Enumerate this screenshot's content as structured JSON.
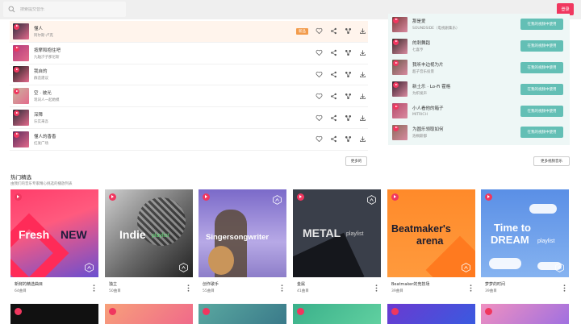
{
  "search": {
    "placeholder": "搜索提交音乐"
  },
  "header": {
    "login_label": "登录"
  },
  "tracks": [
    {
      "title": "懂人",
      "artist": "阿尔斯·卢克",
      "badge": "新品",
      "cover": "#2b2b3a",
      "active": true
    },
    {
      "title": "按摩和抱住吧",
      "artist": "九轴汐子那尼斯",
      "cover": "#b03a7a"
    },
    {
      "title": "我自的",
      "artist": "群造建议",
      "cover": "#1d1d1d"
    },
    {
      "title": "空 · 彼光",
      "artist": "现词人一起她模",
      "cover": "#c9b7a0"
    },
    {
      "title": "深障",
      "artist": "乐实来吾",
      "cover": "#272a35"
    },
    {
      "title": "懂人的香香",
      "artist": "红发广场",
      "cover": "#5a2a5a"
    }
  ],
  "tracks_more_label": "更多的",
  "right_panel": {
    "items": [
      {
        "title": "那是爱",
        "artist": "SOUNDSIDE（电视剧集乐）",
        "cover": "#7a3b3b"
      },
      {
        "title": "的刺舞蹈",
        "artist": "七喜亨",
        "cover": "#3a2a2a"
      },
      {
        "title": "我听丰边视为片",
        "artist": "超子音乐投景",
        "cover": "#6a5a4a"
      },
      {
        "title": "新土乐 · Lo-Fi 霍格",
        "artist": "为织发声",
        "cover": "#3a1e2e"
      },
      {
        "title": "小人看他的箱子",
        "artist": "MITRICH",
        "cover": "#b54a6a"
      },
      {
        "title": "为圆乐领取如何",
        "artist": "浩桐薪都",
        "cover": "#8a6a5a"
      }
    ],
    "use_label": "在我的视频中使用",
    "more_label": "更多视频音乐"
  },
  "hot": {
    "title": "热门精选",
    "subtitle": "由我们的音乐专家精心挑选的播放列表",
    "playlists": [
      {
        "name": "新鲜的精选曲目",
        "count": "64曲目",
        "art_word1": "Fresh",
        "art_word2": "NEW"
      },
      {
        "name": "独立",
        "count": "50曲目",
        "art_word1": "Indie",
        "art_word2": "playlist"
      },
      {
        "name": "创作歌手",
        "count": "55曲目",
        "art_word1": "Singersongwriter"
      },
      {
        "name": "金属",
        "count": "41曲目",
        "art_word1": "METAL",
        "art_word2": "playlist"
      },
      {
        "name": "Beatmaker的竞技场",
        "count": "39曲目",
        "art_word1": "Beatmaker's",
        "art_word2": "arena"
      },
      {
        "name": "梦梦的时间",
        "count": "39曲目",
        "art_word1": "Time to",
        "art_word2": "DREAM",
        "art_word3": "playlist"
      }
    ]
  },
  "colors": {
    "accent": "#f0375f",
    "teal": "#63bfb5",
    "badge": "#f29b4b",
    "panel": "#eef7f6"
  }
}
